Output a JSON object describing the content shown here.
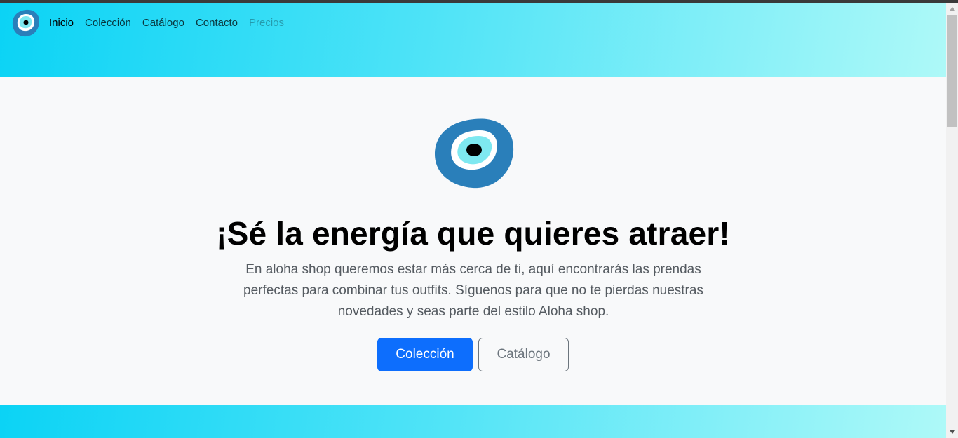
{
  "nav": {
    "logo_icon": "evil-eye-icon",
    "items": [
      {
        "label": "Inicio",
        "state": "active"
      },
      {
        "label": "Colección",
        "state": "normal"
      },
      {
        "label": "Catálogo",
        "state": "normal"
      },
      {
        "label": "Contacto",
        "state": "normal"
      },
      {
        "label": "Precios",
        "state": "disabled"
      }
    ]
  },
  "hero": {
    "logo_icon": "evil-eye-icon",
    "title": "¡Sé la energía que quieres atraer!",
    "text": "En aloha shop queremos estar más cerca de ti, aquí encontrarás las prendas perfectas para combinar tus outfits. Síguenos para que no te pierdas nuestras novedades y seas parte del estilo Aloha shop.",
    "primary_button": "Colección",
    "secondary_button": "Catálogo"
  },
  "colors": {
    "gradient_start": "#0bd3f5",
    "gradient_end": "#aef9f8",
    "hero_bg": "#f8f9fa",
    "primary": "#0d6efd",
    "secondary": "#6c757d",
    "eye_outer": "#2a7fba",
    "eye_middle": "#ffffff",
    "eye_inner": "#7ee8f0",
    "eye_pupil": "#000000"
  }
}
